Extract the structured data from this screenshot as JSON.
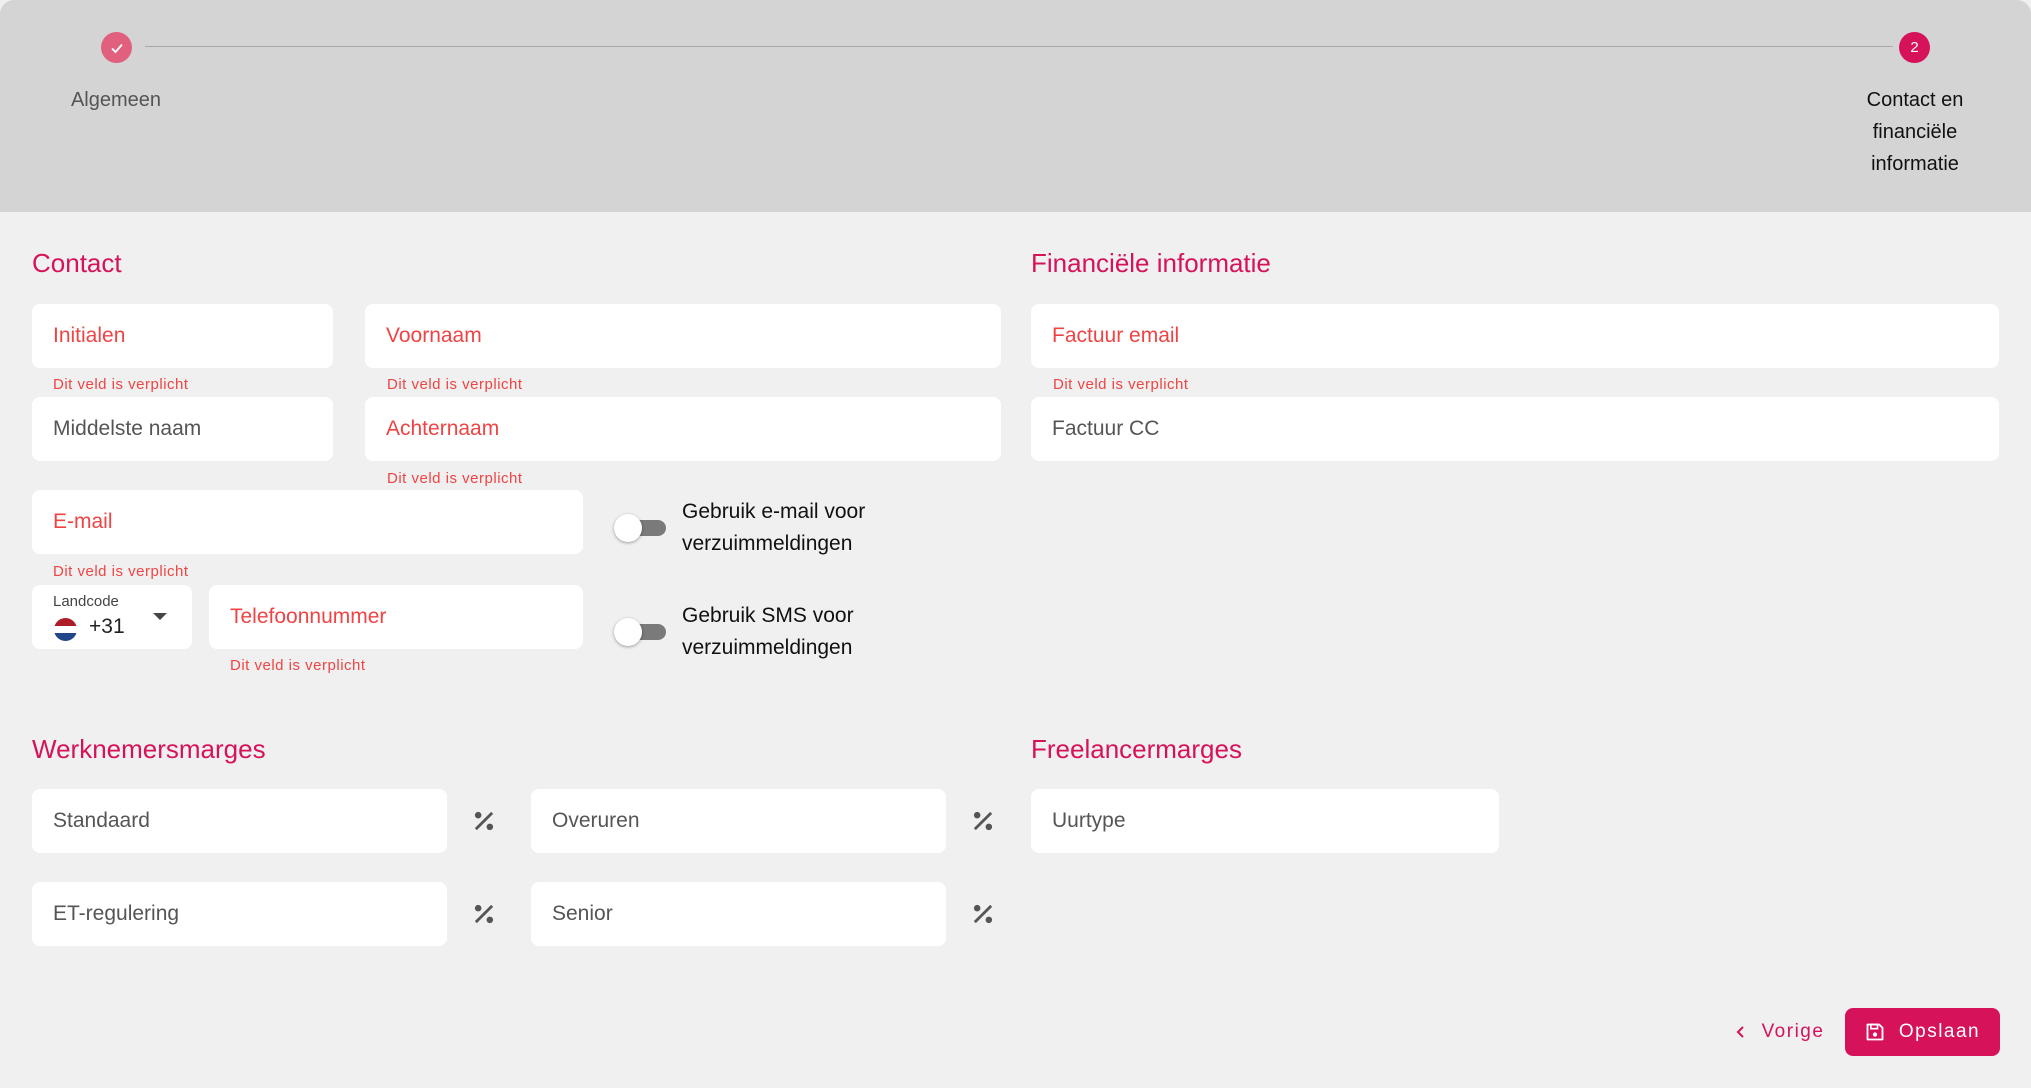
{
  "stepper": {
    "steps": [
      {
        "label": "Algemeen",
        "state": "completed"
      },
      {
        "label": "Contact en financiële informatie",
        "number": "2",
        "state": "active"
      }
    ],
    "colors": {
      "completed": "#e0607e",
      "active": "#d6125a"
    }
  },
  "contact": {
    "title": "Contact",
    "initialen": {
      "placeholder": "Initialen",
      "error": "Dit veld is verplicht"
    },
    "voornaam": {
      "placeholder": "Voornaam",
      "error": "Dit veld is verplicht"
    },
    "middelste_naam": {
      "placeholder": "Middelste naam"
    },
    "achternaam": {
      "placeholder": "Achternaam",
      "error": "Dit veld is verplicht"
    },
    "email": {
      "placeholder": "E-mail",
      "error": "Dit veld is verplicht"
    },
    "email_toggle": {
      "label": "Gebruik e-mail voor verzuimmeldingen",
      "checked": false
    },
    "landcode": {
      "label": "Landcode",
      "value": "+31",
      "flag": "netherlands-flag"
    },
    "telefoon": {
      "placeholder": "Telefoonnummer",
      "error": "Dit veld is verplicht"
    },
    "sms_toggle": {
      "label": "Gebruik SMS voor verzuimmeldingen",
      "checked": false
    }
  },
  "financieel": {
    "title": "Financiële informatie",
    "factuur_email": {
      "placeholder": "Factuur email",
      "error": "Dit veld is verplicht"
    },
    "factuur_cc": {
      "placeholder": "Factuur CC"
    }
  },
  "werknemersmarges": {
    "title": "Werknemersmarges",
    "standaard": "Standaard",
    "overuren": "Overuren",
    "et_regulering": "ET-regulering",
    "senior": "Senior",
    "unit_icon": "percent-icon"
  },
  "freelancermarges": {
    "title": "Freelancermarges",
    "uurtype": "Uurtype"
  },
  "actions": {
    "prev_label": "Vorige",
    "save_label": "Opslaan"
  },
  "theme": {
    "accent": "#d6125a",
    "error": "#ef4444"
  }
}
